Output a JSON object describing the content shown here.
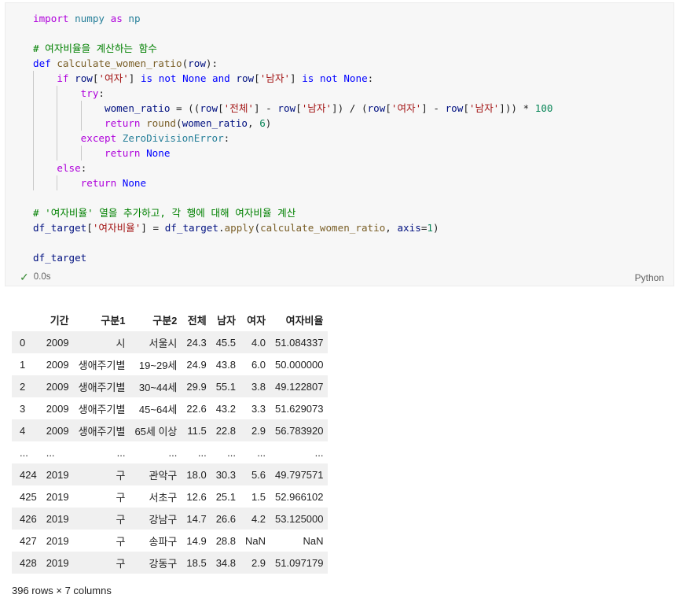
{
  "code_lines": [
    [
      {
        "t": "import",
        "c": "kw-ctrl"
      },
      {
        "t": " "
      },
      {
        "t": "numpy",
        "c": "mod"
      },
      {
        "t": " "
      },
      {
        "t": "as",
        "c": "kw-ctrl"
      },
      {
        "t": " "
      },
      {
        "t": "np",
        "c": "mod"
      }
    ],
    [],
    [
      {
        "t": "# 여자비율을 계산하는 함수",
        "c": "cmt"
      }
    ],
    [
      {
        "t": "def",
        "c": "kw"
      },
      {
        "t": " "
      },
      {
        "t": "calculate_women_ratio",
        "c": "fn"
      },
      {
        "t": "("
      },
      {
        "t": "row",
        "c": "var"
      },
      {
        "t": "):"
      }
    ],
    [
      {
        "t": "    "
      },
      {
        "t": "if",
        "c": "kw-ctrl"
      },
      {
        "t": " "
      },
      {
        "t": "row",
        "c": "var"
      },
      {
        "t": "["
      },
      {
        "t": "'여자'",
        "c": "str"
      },
      {
        "t": "] "
      },
      {
        "t": "is",
        "c": "kw"
      },
      {
        "t": " "
      },
      {
        "t": "not",
        "c": "kw"
      },
      {
        "t": " "
      },
      {
        "t": "None",
        "c": "kw"
      },
      {
        "t": " "
      },
      {
        "t": "and",
        "c": "kw"
      },
      {
        "t": " "
      },
      {
        "t": "row",
        "c": "var"
      },
      {
        "t": "["
      },
      {
        "t": "'남자'",
        "c": "str"
      },
      {
        "t": "] "
      },
      {
        "t": "is",
        "c": "kw"
      },
      {
        "t": " "
      },
      {
        "t": "not",
        "c": "kw"
      },
      {
        "t": " "
      },
      {
        "t": "None",
        "c": "kw"
      },
      {
        "t": ":"
      }
    ],
    [
      {
        "t": "        "
      },
      {
        "t": "try",
        "c": "kw-ctrl"
      },
      {
        "t": ":"
      }
    ],
    [
      {
        "t": "            "
      },
      {
        "t": "women_ratio",
        "c": "var"
      },
      {
        "t": " = (("
      },
      {
        "t": "row",
        "c": "var"
      },
      {
        "t": "["
      },
      {
        "t": "'전체'",
        "c": "str"
      },
      {
        "t": "] - "
      },
      {
        "t": "row",
        "c": "var"
      },
      {
        "t": "["
      },
      {
        "t": "'남자'",
        "c": "str"
      },
      {
        "t": "]) / ("
      },
      {
        "t": "row",
        "c": "var"
      },
      {
        "t": "["
      },
      {
        "t": "'여자'",
        "c": "str"
      },
      {
        "t": "] - "
      },
      {
        "t": "row",
        "c": "var"
      },
      {
        "t": "["
      },
      {
        "t": "'남자'",
        "c": "str"
      },
      {
        "t": "])) * "
      },
      {
        "t": "100",
        "c": "num"
      }
    ],
    [
      {
        "t": "            "
      },
      {
        "t": "return",
        "c": "kw-ctrl"
      },
      {
        "t": " "
      },
      {
        "t": "round",
        "c": "fn"
      },
      {
        "t": "("
      },
      {
        "t": "women_ratio",
        "c": "var"
      },
      {
        "t": ", "
      },
      {
        "t": "6",
        "c": "num"
      },
      {
        "t": ")"
      }
    ],
    [
      {
        "t": "        "
      },
      {
        "t": "except",
        "c": "kw-ctrl"
      },
      {
        "t": " "
      },
      {
        "t": "ZeroDivisionError",
        "c": "cls"
      },
      {
        "t": ":"
      }
    ],
    [
      {
        "t": "            "
      },
      {
        "t": "return",
        "c": "kw-ctrl"
      },
      {
        "t": " "
      },
      {
        "t": "None",
        "c": "kw"
      }
    ],
    [
      {
        "t": "    "
      },
      {
        "t": "else",
        "c": "kw-ctrl"
      },
      {
        "t": ":"
      }
    ],
    [
      {
        "t": "        "
      },
      {
        "t": "return",
        "c": "kw-ctrl"
      },
      {
        "t": " "
      },
      {
        "t": "None",
        "c": "kw"
      }
    ],
    [],
    [
      {
        "t": "# '여자비율' 열을 추가하고, 각 행에 대해 여자비율 계산",
        "c": "cmt"
      }
    ],
    [
      {
        "t": "df_target",
        "c": "var"
      },
      {
        "t": "["
      },
      {
        "t": "'여자비율'",
        "c": "str"
      },
      {
        "t": "] = "
      },
      {
        "t": "df_target",
        "c": "var"
      },
      {
        "t": "."
      },
      {
        "t": "apply",
        "c": "fn"
      },
      {
        "t": "("
      },
      {
        "t": "calculate_women_ratio",
        "c": "fn"
      },
      {
        "t": ", "
      },
      {
        "t": "axis",
        "c": "var"
      },
      {
        "t": "="
      },
      {
        "t": "1",
        "c": "num"
      },
      {
        "t": ")"
      }
    ],
    [],
    [
      {
        "t": "df_target",
        "c": "var"
      }
    ]
  ],
  "cell": {
    "status_time": "0.0s",
    "language": "Python"
  },
  "table": {
    "columns": [
      "",
      "기간",
      "구분1",
      "구분2",
      "전체",
      "남자",
      "여자",
      "여자비율"
    ],
    "rows": [
      [
        "0",
        "2009",
        "시",
        "서울시",
        "24.3",
        "45.5",
        "4.0",
        "51.084337"
      ],
      [
        "1",
        "2009",
        "생애주기별",
        "19~29세",
        "24.9",
        "43.8",
        "6.0",
        "50.000000"
      ],
      [
        "2",
        "2009",
        "생애주기별",
        "30~44세",
        "29.9",
        "55.1",
        "3.8",
        "49.122807"
      ],
      [
        "3",
        "2009",
        "생애주기별",
        "45~64세",
        "22.6",
        "43.2",
        "3.3",
        "51.629073"
      ],
      [
        "4",
        "2009",
        "생애주기별",
        "65세 이상",
        "11.5",
        "22.8",
        "2.9",
        "56.783920"
      ],
      [
        "...",
        "...",
        "...",
        "...",
        "...",
        "...",
        "...",
        "..."
      ],
      [
        "424",
        "2019",
        "구",
        "관악구",
        "18.0",
        "30.3",
        "5.6",
        "49.797571"
      ],
      [
        "425",
        "2019",
        "구",
        "서초구",
        "12.6",
        "25.1",
        "1.5",
        "52.966102"
      ],
      [
        "426",
        "2019",
        "구",
        "강남구",
        "14.7",
        "26.6",
        "4.2",
        "53.125000"
      ],
      [
        "427",
        "2019",
        "구",
        "송파구",
        "14.9",
        "28.8",
        "NaN",
        "NaN"
      ],
      [
        "428",
        "2019",
        "구",
        "강동구",
        "18.5",
        "34.8",
        "2.9",
        "51.097179"
      ]
    ],
    "shape_text": "396 rows × 7 columns"
  }
}
